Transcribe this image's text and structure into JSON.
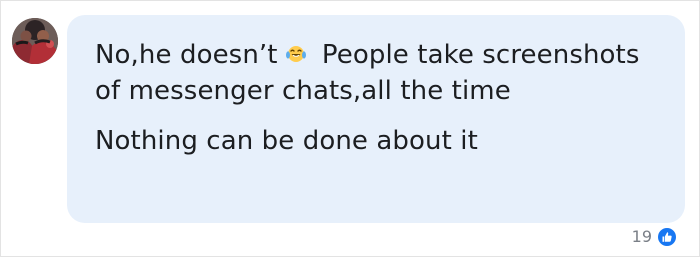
{
  "comment": {
    "text_before_emoji": "No,he doesn’t",
    "emoji_icon": "joy-tears-icon",
    "text_after_emoji": " People take screenshots of messenger chats,all the time",
    "second_line": "Nothing can be done about it"
  },
  "reactions": {
    "count": "19",
    "icon": "thumbs-up-icon",
    "color": "#1877f2"
  },
  "colors": {
    "bubble": "#e7f0fb",
    "text": "#1c1e21"
  }
}
